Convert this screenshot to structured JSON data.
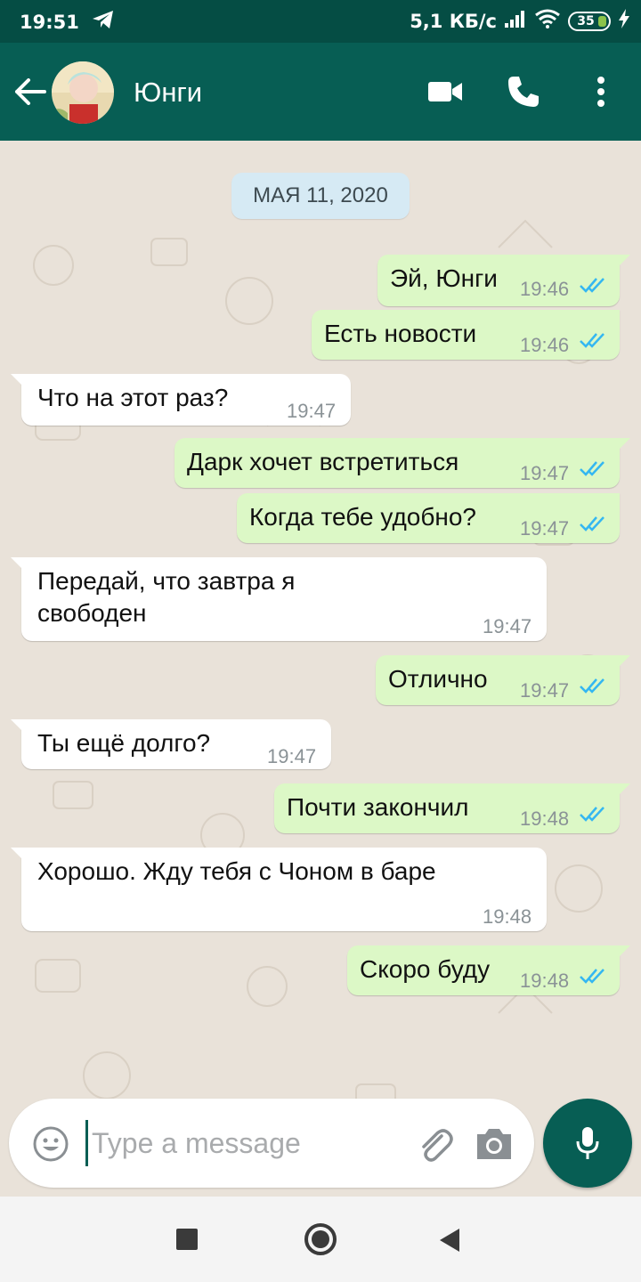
{
  "status_bar": {
    "time": "19:51",
    "network_speed": "5,1 КБ/с",
    "battery": "35"
  },
  "header": {
    "contact_name": "Юнги"
  },
  "chat": {
    "date": "МАЯ 11, 2020",
    "messages": [
      {
        "direction": "out",
        "text": "Эй, Юнги",
        "time": "19:46",
        "read": true
      },
      {
        "direction": "out",
        "text": "Есть новости",
        "time": "19:46",
        "read": true
      },
      {
        "direction": "in",
        "text": "Что на этот раз?",
        "time": "19:47"
      },
      {
        "direction": "out",
        "text": "Дарк хочет встретиться",
        "time": "19:47",
        "read": true
      },
      {
        "direction": "out",
        "text": "Когда тебе удобно?",
        "time": "19:47",
        "read": true
      },
      {
        "direction": "in",
        "text": "Передай, что завтра я свободен",
        "time": "19:47"
      },
      {
        "direction": "out",
        "text": "Отлично",
        "time": "19:47",
        "read": true
      },
      {
        "direction": "in",
        "text": "Ты ещё долго?",
        "time": "19:47"
      },
      {
        "direction": "out",
        "text": "Почти закончил",
        "time": "19:48",
        "read": true
      },
      {
        "direction": "in",
        "text": "Хорошо. Жду тебя с Чоном в баре",
        "time": "19:48"
      },
      {
        "direction": "out",
        "text": "Скоро буду",
        "time": "19:48",
        "read": true
      }
    ]
  },
  "composer": {
    "placeholder": "Type a message"
  },
  "colors": {
    "header": "#075e54",
    "status_bar": "#054d44",
    "outgoing_bubble": "#dcf8c6",
    "incoming_bubble": "#ffffff",
    "read_ticks": "#34b7f1"
  }
}
